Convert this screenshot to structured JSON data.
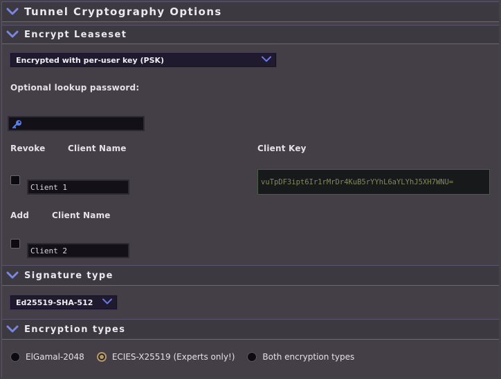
{
  "sections": {
    "tunnel_crypto": "Tunnel Cryptography Options",
    "encrypt_leaseset": "Encrypt Leaseset",
    "signature_type": "Signature type",
    "encryption_types": "Encryption types"
  },
  "leaseset": {
    "mode_selected": "Encrypted with per-user key (PSK)",
    "lookup_password_label": "Optional lookup password:",
    "lookup_password_value": ""
  },
  "clients": {
    "revoke_label": "Revoke",
    "client_name_label": "Client Name",
    "client_key_label": "Client Key",
    "existing_client_name": "Client 1",
    "existing_client_key": "vuTpDF3ipt6Ir1rMrDr4KuB5rYYhL6aYLYhJ5XH7WNU=",
    "add_label": "Add",
    "add_client_name_label": "Client Name",
    "new_client_name": "Client 2"
  },
  "signature": {
    "selected": "Ed25519-SHA-512"
  },
  "encryption": {
    "options": [
      "ElGamal-2048",
      "ECIES-X25519 (Experts only!)",
      "Both encryption types"
    ],
    "selected_index": 1
  },
  "colors": {
    "accent": "#6a62a0",
    "chevron": "#7b86e0",
    "radio_selected": "#b59a6a"
  }
}
